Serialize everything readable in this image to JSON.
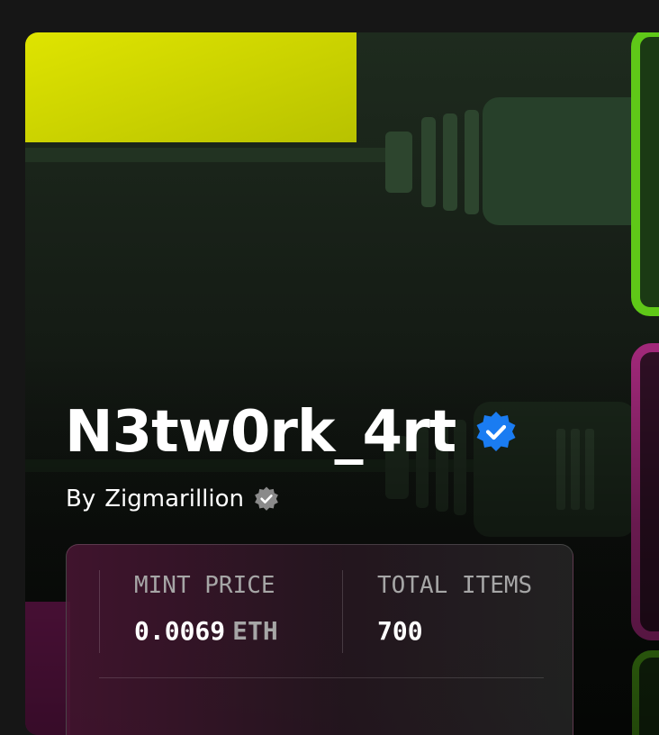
{
  "collection": {
    "title": "N3tw0rk_4rt",
    "verified_icon": "verified-badge-icon",
    "creator_prefix": "By",
    "creator_name": "Zigmarillion",
    "creator_badge_icon": "verified-badge-icon"
  },
  "stats": [
    {
      "label": "MINT PRICE",
      "value": "0.0069",
      "unit": "ETH"
    },
    {
      "label": "TOTAL ITEMS",
      "value": "700"
    }
  ],
  "colors": {
    "verified_blue": "#1a7cf2",
    "creator_badge_gray": "#8a8a8a",
    "artwork_yellow": "#d4dc00",
    "artwork_green": "#5fc818",
    "artwork_magenta": "#a02879"
  }
}
